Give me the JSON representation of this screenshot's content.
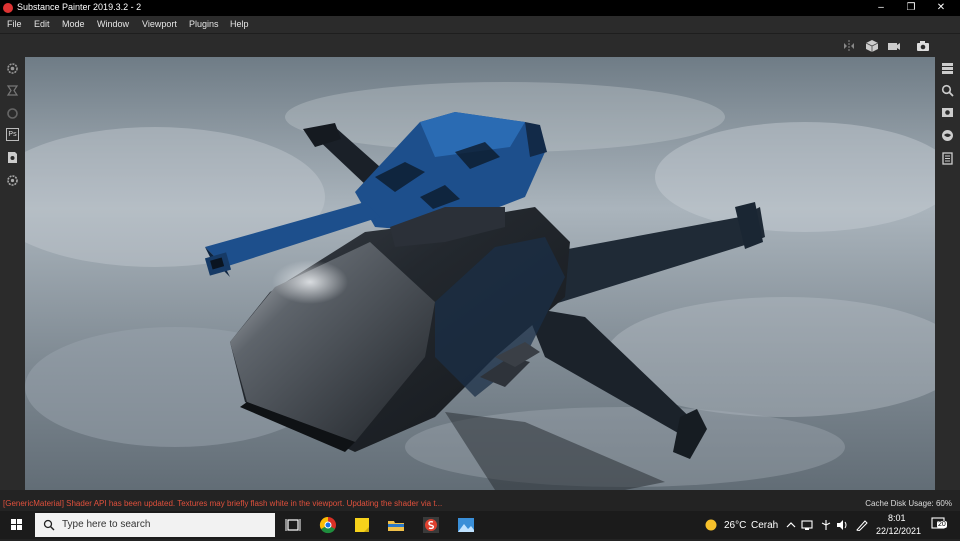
{
  "window": {
    "title": "Substance Painter 2019.3.2 - 2",
    "controls": [
      "minimize",
      "restore",
      "close"
    ]
  },
  "menu": {
    "items": [
      "File",
      "Edit",
      "Mode",
      "Window",
      "Viewport",
      "Plugins",
      "Help"
    ]
  },
  "toolbar": {
    "icons": [
      "symmetry-icon",
      "cube-display-icon",
      "camera-video-icon",
      "screenshot-icon"
    ]
  },
  "left_sidebar": {
    "icons": [
      "settings-gear-icon",
      "bake-icon",
      "shader-icon",
      "photoshop-export-icon",
      "export-icon",
      "settings-icon"
    ],
    "photoshop_label": "Ps"
  },
  "right_sidebar": {
    "icons": [
      "layers-icon",
      "search-icon",
      "display-settings-icon",
      "environment-icon",
      "history-icon"
    ]
  },
  "status": {
    "message": "[GenericMaterial] Shader API has been updated. Textures may briefly flash white in the viewport. Updating the shader via t...",
    "cache_label": "Cache Disk Usage:",
    "cache_value": "60%"
  },
  "taskbar": {
    "search_placeholder": "Type here to search",
    "apps": [
      "task-view-icon",
      "chrome-icon",
      "sticky-notes-icon",
      "file-explorer-icon",
      "substance-painter-icon",
      "photos-icon"
    ],
    "weather_temp": "26°C",
    "weather_desc": "Cerah",
    "time": "8:01",
    "date": "22/12/2021",
    "notification_count": "20"
  },
  "colors": {
    "accent_red": "#e0503c",
    "camo_blue": "#1d4f8c",
    "hull_dark": "#1e2227"
  }
}
